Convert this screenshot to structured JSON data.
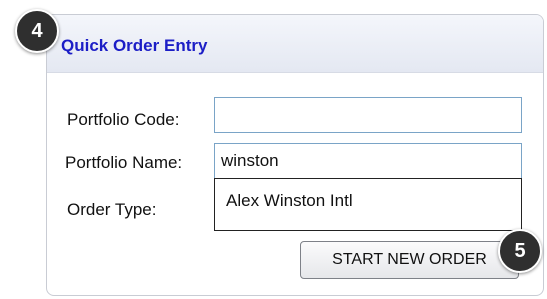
{
  "panel": {
    "title": "Quick Order Entry"
  },
  "form": {
    "portfolio_code": {
      "label": "Portfolio Code:",
      "value": ""
    },
    "portfolio_name": {
      "label": "Portfolio Name:",
      "value": "winston"
    },
    "order_type": {
      "label": "Order Type:"
    }
  },
  "autocomplete": {
    "options": [
      "Alex Winston Intl"
    ]
  },
  "actions": {
    "start_new_order_label": "START NEW ORDER"
  },
  "callouts": {
    "step_4": "4",
    "step_5": "5"
  },
  "colors": {
    "title": "#1c1ec6",
    "badge": "#2f2f2f",
    "input_border": "#7aa4c7"
  }
}
